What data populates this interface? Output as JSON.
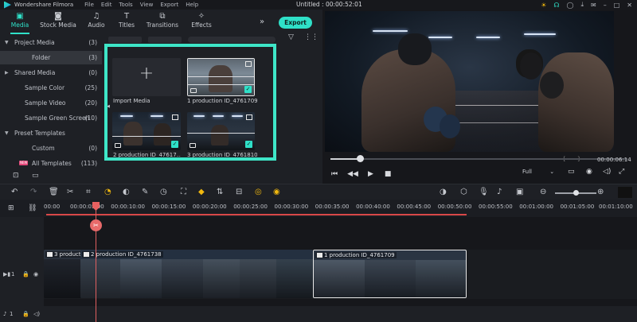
{
  "app": {
    "name": "Wondershare Filmora",
    "menu": [
      "File",
      "Edit",
      "Tools",
      "View",
      "Export",
      "Help"
    ],
    "window_title": "Untitled : 00:00:52:01"
  },
  "tabs": [
    {
      "label": "Media",
      "icon": "media-icon",
      "active": true
    },
    {
      "label": "Stock Media",
      "icon": "stock-media-icon",
      "active": false
    },
    {
      "label": "Audio",
      "icon": "audio-icon",
      "active": false
    },
    {
      "label": "Titles",
      "icon": "titles-icon",
      "active": false
    },
    {
      "label": "Transitions",
      "icon": "transitions-icon",
      "active": false
    },
    {
      "label": "Effects",
      "icon": "effects-icon",
      "active": false
    }
  ],
  "export_label": "Export",
  "sidebar": {
    "items": [
      {
        "label": "Project Media",
        "count": "(3)",
        "expandable": true
      },
      {
        "label": "Folder",
        "count": "(3)",
        "selected": true
      },
      {
        "label": "Shared Media",
        "count": "(0)",
        "expandable": true
      },
      {
        "label": "Sample Color",
        "count": "(25)"
      },
      {
        "label": "Sample Video",
        "count": "(20)"
      },
      {
        "label": "Sample Green Screen",
        "count": "(10)"
      },
      {
        "label": "Preset Templates",
        "count": "",
        "expandable": true
      },
      {
        "label": "Custom",
        "count": "(0)"
      },
      {
        "label": "All Templates",
        "count": "(113)",
        "badge": "NEW"
      }
    ]
  },
  "media": {
    "import_label": "Import Media",
    "items": [
      {
        "caption": "1 production ID_4761709",
        "selected": true
      },
      {
        "caption": "2 production ID_47617...",
        "selected": true
      },
      {
        "caption": "3 production ID_4761810",
        "selected": true
      }
    ]
  },
  "player": {
    "time": "00:00:06:14",
    "quality": "Full",
    "progress": 0.1
  },
  "timeline": {
    "ruler": [
      "00:00",
      "00:00:05:00",
      "00:00:10:00",
      "00:00:15:00",
      "00:00:20:00",
      "00:00:25:00",
      "00:00:30:00",
      "00:00:35:00",
      "00:00:40:00",
      "00:00:45:00",
      "00:00:50:00",
      "00:00:55:00",
      "00:01:00:00",
      "00:01:05:00",
      "00:01:10:00"
    ],
    "clips": [
      {
        "caption": "3 product"
      },
      {
        "caption": "2 production ID_4761738"
      },
      {
        "caption": "1 production ID_4761709"
      }
    ],
    "tracks": {
      "video": "1",
      "audio": "1"
    }
  },
  "colors": {
    "accent": "#2fe0c8",
    "highlight": "#3ee6c8",
    "playhead": "#e06060"
  }
}
